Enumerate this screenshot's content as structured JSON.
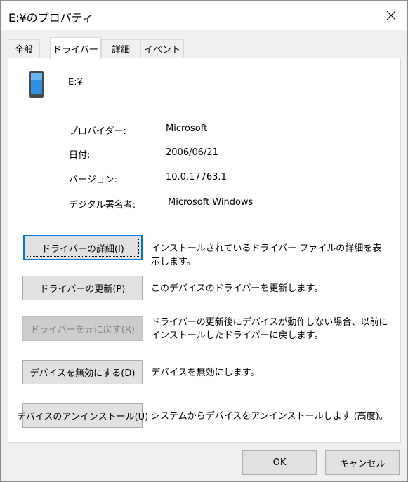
{
  "window": {
    "title": "E:¥のプロパティ"
  },
  "tabs": [
    {
      "label": "全般"
    },
    {
      "label": "ドライバー"
    },
    {
      "label": "詳細"
    },
    {
      "label": "イベント"
    }
  ],
  "device": {
    "name": "E:¥",
    "icon": "portable-device-icon"
  },
  "info": [
    {
      "label": "プロバイダー:",
      "value": "Microsoft"
    },
    {
      "label": "日付:",
      "value": "2006/06/21"
    },
    {
      "label": "バージョン:",
      "value": "10.0.17763.1"
    },
    {
      "label": "デジタル署名者:",
      "value": "Microsoft Windows"
    }
  ],
  "actions": [
    {
      "label": "ドライバーの詳細(I)",
      "description": "インストールされているドライバー ファイルの詳細を表示します。",
      "enabled": true
    },
    {
      "label": "ドライバーの更新(P)",
      "description": "このデバイスのドライバーを更新します。",
      "enabled": true
    },
    {
      "label": "ドライバーを元に戻す(R)",
      "description": "ドライバーの更新後にデバイスが動作しない場合、以前にインストールしたドライバーに戻します。",
      "enabled": false
    },
    {
      "label": "デバイスを無効にする(D)",
      "description": "デバイスを無効にします。",
      "enabled": true
    },
    {
      "label": "デバイスのアンインストール(U)",
      "description": "システムからデバイスをアンインストールします (高度)。",
      "enabled": true
    }
  ],
  "footer": {
    "ok_label": "OK",
    "cancel_label": "キャンセル"
  },
  "colors": {
    "accent": "#0078d7",
    "panel": "#ffffff",
    "background": "#f0f0f0"
  }
}
